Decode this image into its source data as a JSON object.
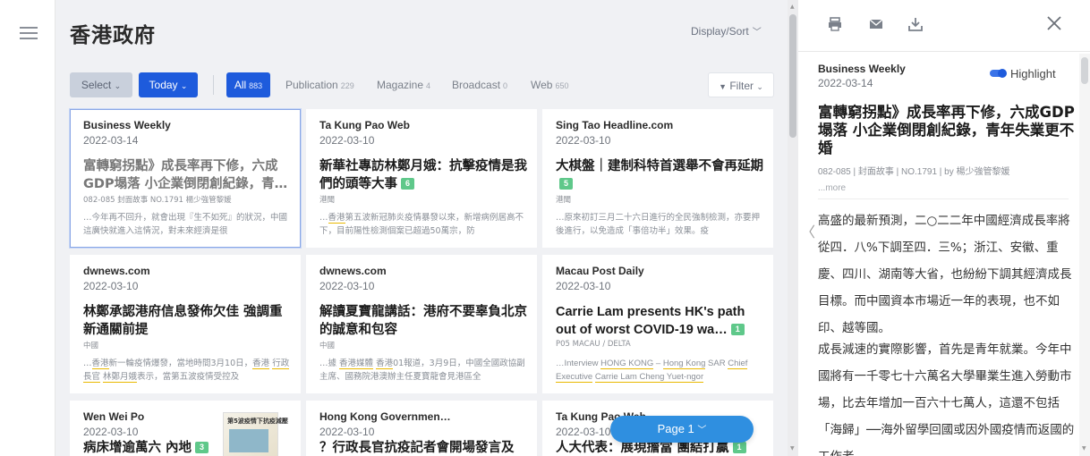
{
  "header": {
    "title": "香港政府",
    "display_sort": "Display/Sort",
    "select_label": "Select",
    "today_label": "Today",
    "filter_label": "Filter"
  },
  "tabs": [
    {
      "label": "All",
      "count": "883"
    },
    {
      "label": "Publication",
      "count": "229"
    },
    {
      "label": "Magazine",
      "count": "4"
    },
    {
      "label": "Broadcast",
      "count": "0"
    },
    {
      "label": "Web",
      "count": "650"
    }
  ],
  "cards": [
    {
      "source": "Business Weekly",
      "date": "2022-03-14",
      "headline": "富轉窮拐點》成長率再下修，六成GDP塌落 小企業倒閉創紀錄，青…",
      "badge": "",
      "sub": "082-085 封面故事 NO.1791 楊少強管黎媛",
      "snippet": "…今年再不回升，就會出現『生不如死』的狀況，中國這廣快就進入這情況，對未來經濟是很"
    },
    {
      "source": "Ta Kung Pao Web",
      "date": "2022-03-10",
      "headline": "新華社專訪林鄭月娥：抗擊疫情是我們的頭等大事",
      "badge": "6",
      "sub": "港聞",
      "snippet": "…香港第五波新冠肺炎疫情暴發以來，新增病例居高不下，目前陽性檢測個案已超過50萬宗，防"
    },
    {
      "source": "Sing Tao Headline.com",
      "date": "2022-03-10",
      "headline": "大棋盤｜建制科特首選舉不會再延期",
      "badge": "5",
      "sub": "港聞",
      "snippet": "…原來初訂三月二十六日進行的全民強制檢測，亦要押後進行，以免造成「事倍功半」效果。疫"
    },
    {
      "source": "dwnews.com",
      "date": "2022-03-10",
      "headline": "林鄭承認港府信息發佈欠佳 強調重新通關前提",
      "badge": "",
      "sub": "中國",
      "snippet": "…香港新一輪疫情爆發，當地時間3月10日，香港 行政長官 林鄭月娥表示，當第五波疫情受控及"
    },
    {
      "source": "dwnews.com",
      "date": "2022-03-10",
      "headline": "解讀夏寶龍講話：港府不要辜負北京的誠意和包容",
      "badge": "",
      "sub": "中國",
      "snippet": "…據 香港媒體 香港01報道，3月9日，中國全國政協副主席、國務院港澳辦主任夏寶龍會見港區全"
    },
    {
      "source": "Macau Post Daily",
      "date": "2022-03-10",
      "headline": "Carrie Lam presents HK's path out of worst COVID-19 wa…",
      "badge": "1",
      "sub": "P05 MACAU / DELTA",
      "snippet": "…Interview HONG KONG – Hong Kong SAR Chief Executive Carrie Lam Cheng Yuet-ngor"
    },
    {
      "source": "Wen Wei Po",
      "date": "2022-03-10",
      "headline": "病床增逾萬六 內地",
      "badge": "3",
      "sub": "",
      "snippet": "",
      "thumb_text": "第5波疫情下抗疫減壓"
    },
    {
      "source": "Hong Kong Governmen…",
      "date": "2022-03-10",
      "headline": "？行政長官抗疫記者會開場發言及",
      "badge": "",
      "sub": "",
      "snippet": ""
    },
    {
      "source": "Ta Kung Pao Web",
      "date": "2022-03-10",
      "headline": "人大代表：展現擔當 團結打贏",
      "badge": "1",
      "sub": "",
      "snippet": ""
    }
  ],
  "pagination": {
    "label": "Page 1"
  },
  "reader": {
    "source": "Business Weekly",
    "date": "2022-03-14",
    "highlight_label": "Highlight",
    "title": "富轉窮拐點》成長率再下修，六成GDP塌落 小企業倒閉創紀錄，青年失業更不婚",
    "meta": "082-085 | 封面故事 | NO.1791 | by 楊少強管黎媛",
    "more": "...more",
    "para1": "高盛的最新預測，二○二二年中國經濟成長率將從四．八%下調至四．三%；浙江、安徽、重慶、四川、湖南等大省，也紛紛下調其經濟成長目標。而中國資本市場近一年的表現，也不如印、越等國。",
    "para2": "成長減速的實際影響，首先是青年就業。今年中國將有一千零七十六萬名大學畢業生進入勞動市場，比去年增加一百六十七萬人，這還不包括「海歸」──海外留學回國或因外國疫情而返國的工作者。"
  },
  "colors": {
    "accent": "#1e5bdc",
    "badge": "#5fc88a",
    "page_pill": "#2f8fe0"
  },
  "icons": [
    "hamburger-icon",
    "print-icon",
    "mail-icon",
    "download-icon",
    "close-icon",
    "filter-icon",
    "chevron-left-icon"
  ]
}
